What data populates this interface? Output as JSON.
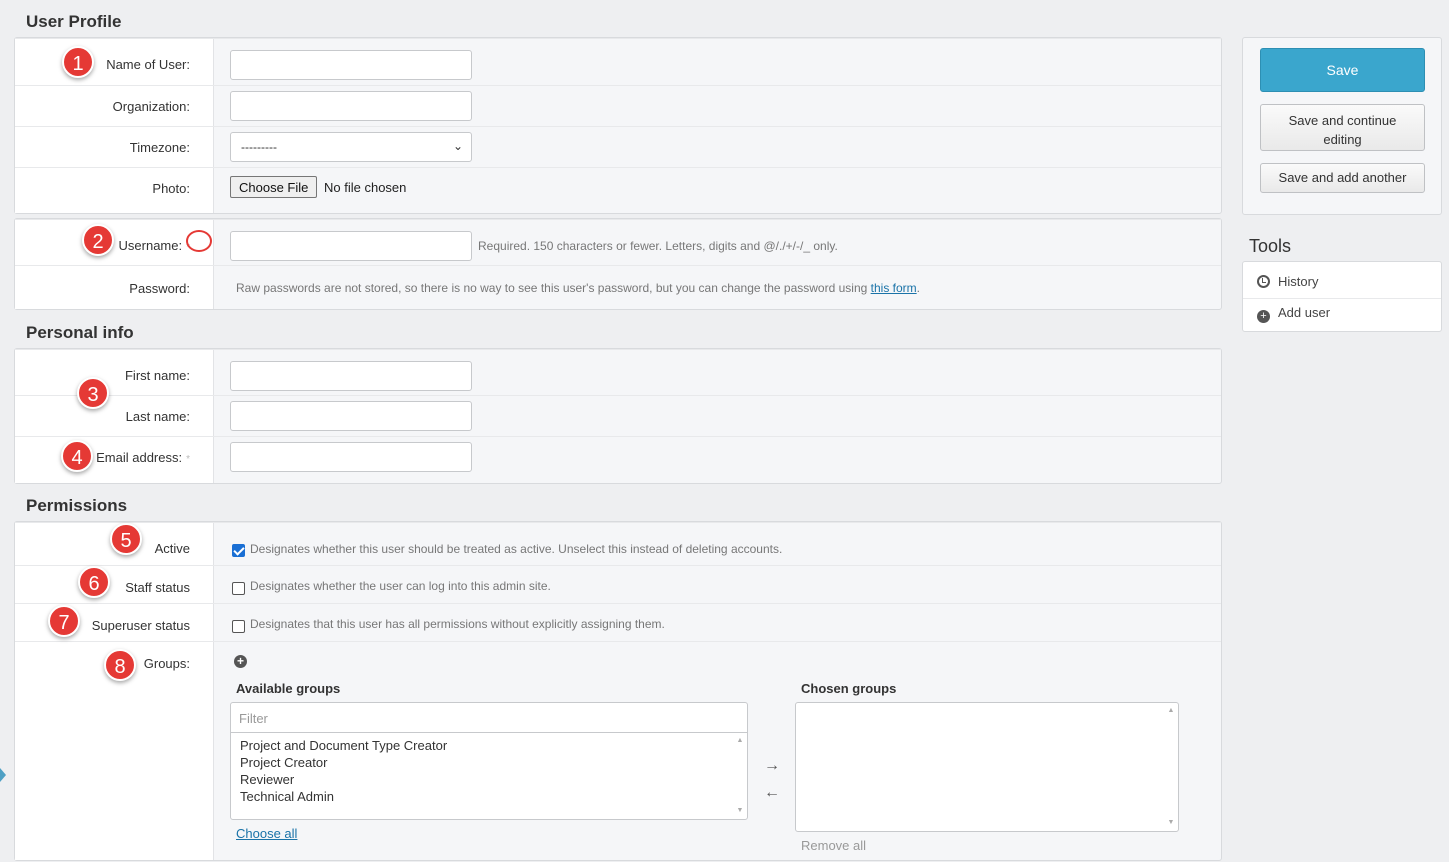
{
  "sections": {
    "user_profile": "User Profile",
    "personal_info": "Personal info",
    "permissions": "Permissions"
  },
  "profile": {
    "name_label": "Name of User:",
    "organization_label": "Organization:",
    "timezone_label": "Timezone:",
    "timezone_value": "---------",
    "photo_label": "Photo:",
    "photo_button": "Choose File",
    "photo_status": "No file chosen"
  },
  "account": {
    "username_label": "Username:",
    "username_help": "Required. 150 characters or fewer. Letters, digits and @/./+/-/_ only.",
    "password_label": "Password:",
    "password_help": "Raw passwords are not stored, so there is no way to see this user's password, but you can change the password using",
    "password_link": "this form",
    "password_help_end": "."
  },
  "personal": {
    "first_name_label": "First name:",
    "last_name_label": "Last name:",
    "email_label": "Email address:",
    "required_mark": "*"
  },
  "permissions": {
    "active_label": "Active",
    "active_checked": true,
    "active_help": "Designates whether this user should be treated as active. Unselect this instead of deleting accounts.",
    "staff_label": "Staff status",
    "staff_checked": false,
    "staff_help": "Designates whether the user can log into this admin site.",
    "superuser_label": "Superuser status",
    "superuser_checked": false,
    "superuser_help": "Designates that this user has all permissions without explicitly assigning them.",
    "groups_label": "Groups:",
    "available_title": "Available groups",
    "filter_placeholder": "Filter",
    "available_groups": [
      "Project and Document Type Creator",
      "Project Creator",
      "Reviewer",
      "Technical Admin"
    ],
    "chosen_title": "Chosen groups",
    "choose_all": "Choose all",
    "remove_all": "Remove all"
  },
  "actions": {
    "save": "Save",
    "save_continue": "Save and continue editing",
    "save_add": "Save and add another"
  },
  "tools": {
    "title": "Tools",
    "history": "History",
    "add_user": "Add user"
  },
  "badges": [
    "1",
    "2",
    "3",
    "4",
    "5",
    "6",
    "7",
    "8"
  ],
  "colors": {
    "primary": "#3aa6cd",
    "badge": "#e53935",
    "link": "#1a73a8",
    "checkbox": "#1a6fd4"
  }
}
